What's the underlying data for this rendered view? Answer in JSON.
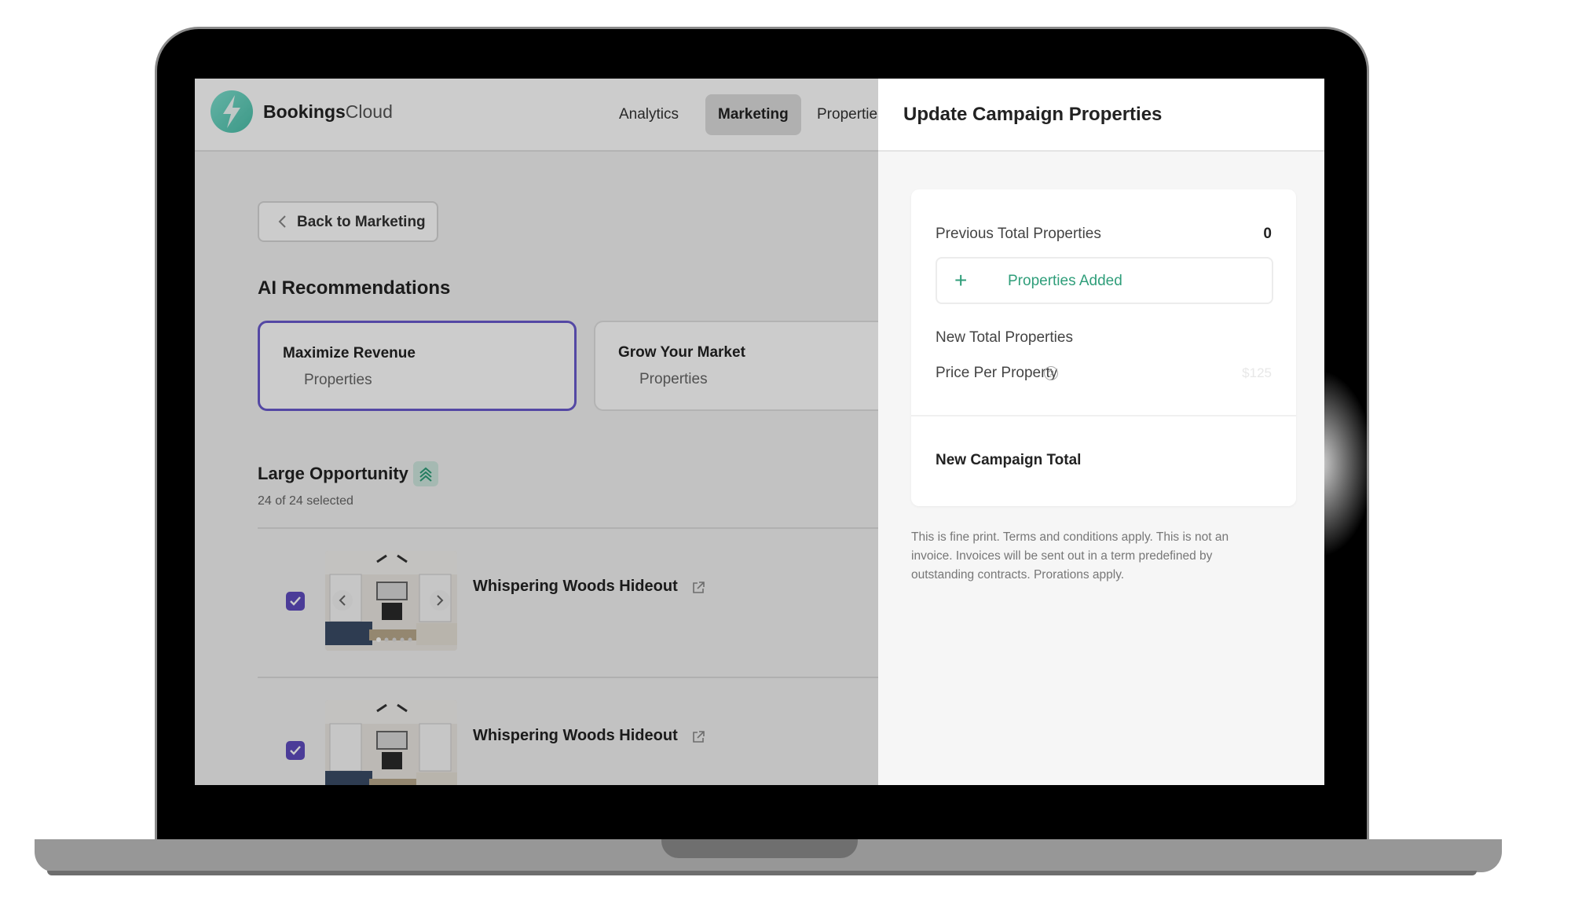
{
  "app": {
    "brand_bold": "Bookings",
    "brand_light": "Cloud"
  },
  "nav": [
    {
      "label": "Analytics",
      "active": false
    },
    {
      "label": "Marketing",
      "active": true
    },
    {
      "label": "Properties",
      "active": false
    }
  ],
  "back_button": {
    "label": "Back to Marketing"
  },
  "recommendations": {
    "title": "AI Recommendations",
    "cards": [
      {
        "title": "Maximize Revenue",
        "subtitle": "Properties",
        "selected": true
      },
      {
        "title": "Grow Your Market",
        "subtitle": "Properties",
        "selected": false
      }
    ]
  },
  "opportunity": {
    "title": "Large Opportunity",
    "selected_text": "24 of 24 selected",
    "properties": [
      {
        "name": "Whispering Woods Hideout",
        "checked": true
      },
      {
        "name": "Whispering Woods Hideout",
        "checked": true
      }
    ]
  },
  "panel": {
    "title": "Update Campaign Properties",
    "previous_total_label": "Previous Total Properties",
    "previous_total_value": "0",
    "properties_added_label": "Properties Added",
    "new_total_label": "New Total Properties",
    "price_per_property_label": "Price Per Property",
    "price_per_property_value": "$125",
    "new_campaign_total_label": "New Campaign Total",
    "fine_print": "This is fine print. Terms and conditions apply. This is not an invoice. Invoices will be sent out in a term predefined by outstanding contracts. Prorations apply."
  },
  "colors": {
    "accent": "#5e4bbf",
    "success": "#2f9e7a",
    "brand": "#56c7b2"
  },
  "icons": {
    "logo": "lightning-bolt-icon",
    "back": "chevron-left-icon",
    "opportunity": "chevron-up-double-icon",
    "external": "external-link-icon",
    "add": "plus-icon",
    "help": "question-circle-icon"
  }
}
